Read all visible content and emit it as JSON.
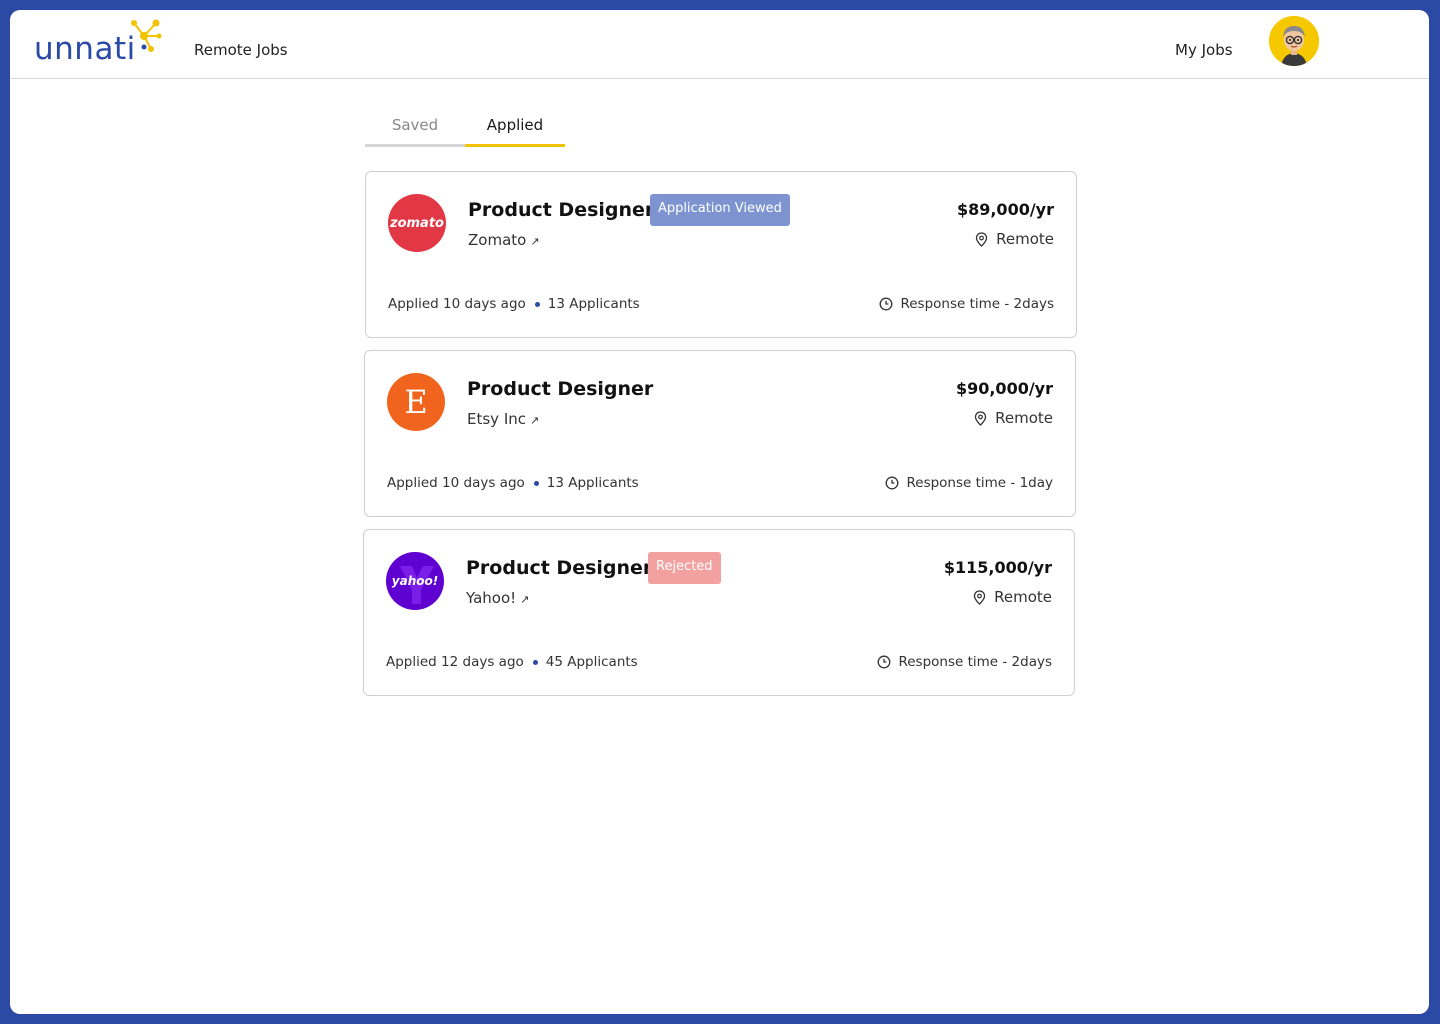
{
  "header": {
    "logo_text": "unnati",
    "nav_remote_jobs": "Remote Jobs",
    "nav_my_jobs": "My Jobs"
  },
  "tabs": [
    {
      "label": "Saved",
      "active": false
    },
    {
      "label": "Applied",
      "active": true
    }
  ],
  "colors": {
    "brand_blue": "#2a4aa6",
    "accent_yellow": "#f3c300",
    "badge_viewed": "#7d94d1",
    "badge_rejected": "#f3a0a0"
  },
  "jobs": [
    {
      "title": "Product Designer",
      "badge": "Application Viewed",
      "company": "Zomato",
      "logo_text": "zomato",
      "salary": "$89,000/yr",
      "location": "Remote",
      "applied": "Applied 10 days ago",
      "applicants": "13 Applicants",
      "response": "Response time - 2days"
    },
    {
      "title": "Product Designer",
      "badge": "",
      "company": "Etsy Inc",
      "logo_text": "E",
      "salary": "$90,000/yr",
      "location": "Remote",
      "applied": "Applied 10 days ago",
      "applicants": "13 Applicants",
      "response": "Response time - 1day"
    },
    {
      "title": "Product Designer",
      "badge": "Rejected",
      "company": "Yahoo!",
      "logo_text": "yahoo!",
      "salary": "$115,000/yr",
      "location": "Remote",
      "applied": "Applied 12 days ago",
      "applicants": "45 Applicants",
      "response": "Response time - 2days"
    }
  ]
}
